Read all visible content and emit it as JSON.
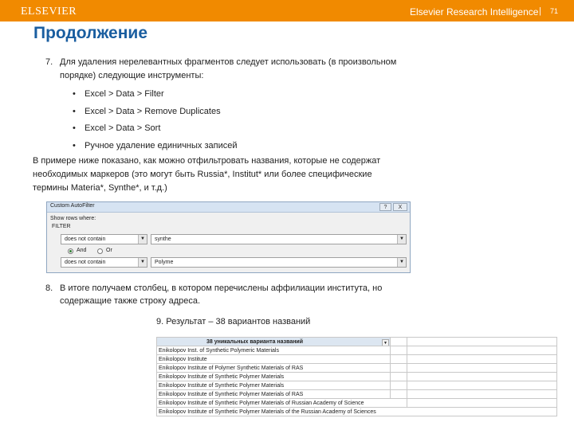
{
  "header": {
    "logo": "ELSEVIER",
    "brand": "Elsevier Research Intelligence",
    "separator": "|",
    "page_number": "71",
    "background_color": "#f18a00"
  },
  "title": "Продолжение",
  "step7": {
    "number": "7.",
    "line1": "Для удаления нерелевантных фрагментов следует использовать (в произвольном",
    "line2": "порядке) следующие инструменты:",
    "bullets": [
      "Excel > Data > Filter",
      "Excel > Data > Remove Duplicates",
      "Excel > Data > Sort",
      "Ручное удаление единичных записей"
    ]
  },
  "example": {
    "line1": "В примере ниже показано, как можно отфильтровать названия, которые не содержат",
    "line2": "необходимых маркеров (это могут быть Russia*, Institut* или более специфические",
    "line3": "термины Materia*, Synthe*, и т.д.)"
  },
  "dialog": {
    "title": "Custom AutoFilter",
    "help": "?",
    "close": "X",
    "show_rows": "Show rows where:",
    "field": "FILTER",
    "op1": "does not contain",
    "val1": "synthe",
    "and_label": "And",
    "or_label": "Or",
    "logic_selected": "And",
    "op2": "does not contain",
    "val2": "Polyme"
  },
  "step8": {
    "number": "8.",
    "line1": "В итоге получаем столбец, в котором перечислены аффилиации института, но",
    "line2": "содержащие также строку адреса."
  },
  "step9": {
    "text": "9.  Результат – 38 вариантов названий"
  },
  "result_table": {
    "header": "38 уникальных варианта названий",
    "rows": [
      "Enikolopov Inst. of Synthetic Polymeric Materials",
      "Enikolopov Institute",
      "Enikolopov Institute of Polymer Synthetic Materials of RAS",
      "Enikolopov Institute of Synthetic Polymer Materials",
      "Enikolopov Institute of Synthetic Polymer Materials",
      "Enikolopov Institute of Synthetic Polymer Materials of RAS",
      "Enikolopov Institute of Synthetic Polymer Materials of Russian Academy of Science",
      "Enikolopov Institute of Synthetic Polymer Materials of the Russian Academy of Sciences"
    ]
  }
}
